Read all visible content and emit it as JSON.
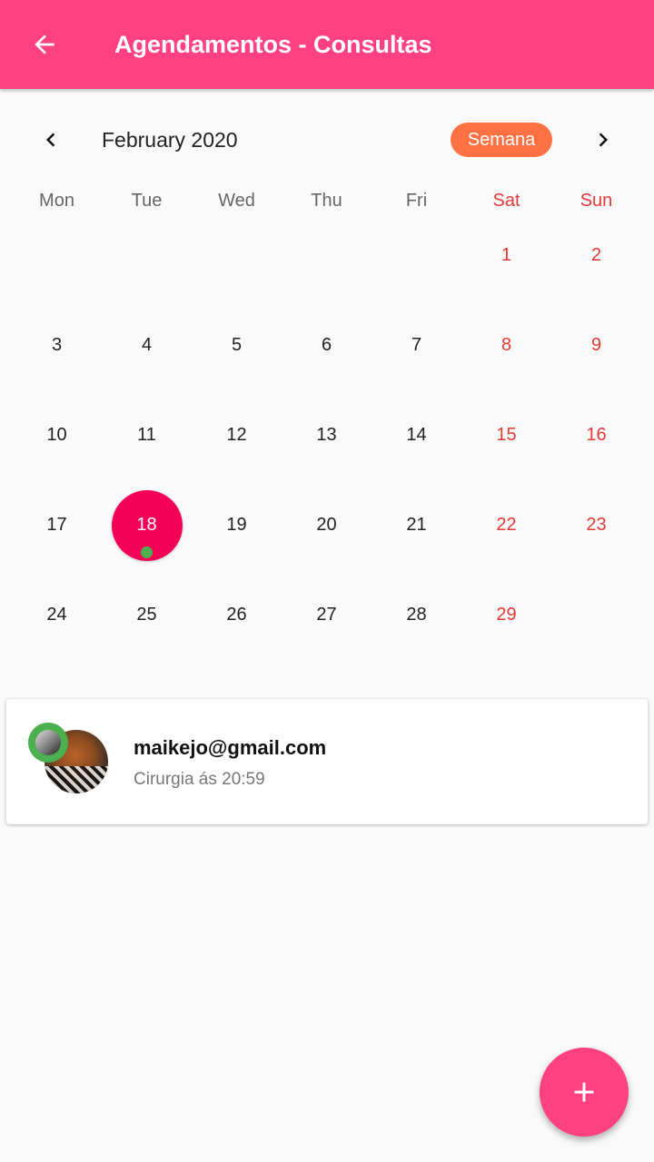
{
  "appbar": {
    "title": "Agendamentos - Consultas",
    "back_icon": "arrow-left-icon",
    "color": "#ff4081"
  },
  "calendar": {
    "month_title": "February 2020",
    "format_button": "Semana",
    "prev_icon": "chevron-left-icon",
    "next_icon": "chevron-right-icon",
    "weekdays": [
      "Mon",
      "Tue",
      "Wed",
      "Thu",
      "Fri",
      "Sat",
      "Sun"
    ],
    "weekend_color": "#e53935",
    "selected_color": "#f50057",
    "event_marker_color": "#4caf50",
    "weeks": [
      [
        "",
        "",
        "",
        "",
        "",
        "1",
        "2"
      ],
      [
        "3",
        "4",
        "5",
        "6",
        "7",
        "8",
        "9"
      ],
      [
        "10",
        "11",
        "12",
        "13",
        "14",
        "15",
        "16"
      ],
      [
        "17",
        "18",
        "19",
        "20",
        "21",
        "22",
        "23"
      ],
      [
        "24",
        "25",
        "26",
        "27",
        "28",
        "29",
        ""
      ]
    ],
    "selected_day": "18"
  },
  "appointment": {
    "email": "maikejo@gmail.com",
    "subtitle": "Cirurgia ás 20:59",
    "status_color": "#4caf50"
  },
  "fab": {
    "icon": "plus-icon",
    "color": "#ff4081"
  }
}
